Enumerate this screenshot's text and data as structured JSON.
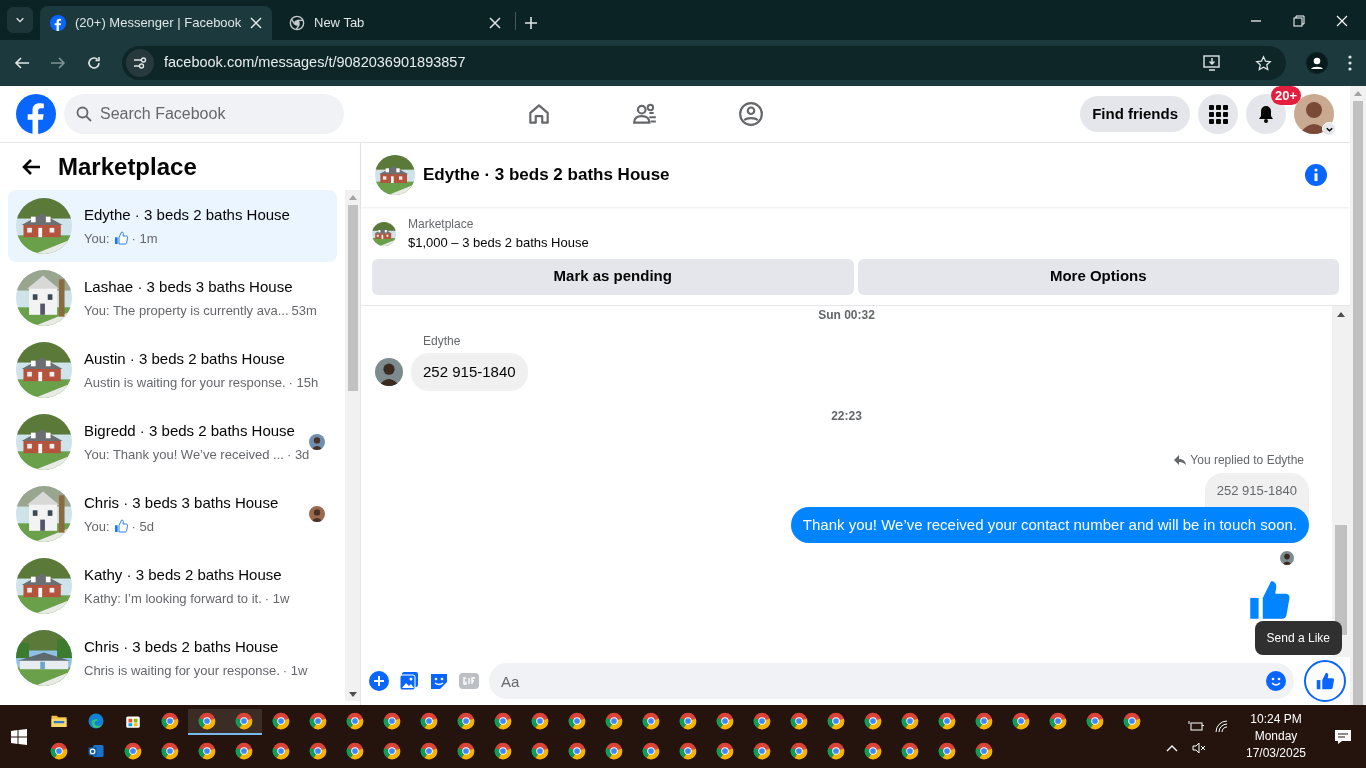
{
  "browser": {
    "tabs": [
      {
        "title": "(20+) Messenger | Facebook",
        "selected": true
      },
      {
        "title": "New Tab",
        "selected": false
      }
    ],
    "url": "facebook.com/messages/t/9082036901893857"
  },
  "header": {
    "search_placeholder": "Search Facebook",
    "nav": [
      {
        "kind": "home",
        "selected": false
      },
      {
        "kind": "friends",
        "selected": false
      },
      {
        "kind": "groups",
        "selected": false
      }
    ],
    "find_friends": "Find friends",
    "notifications_badge": "20+"
  },
  "sidebar": {
    "title": "Marketplace",
    "conversations": [
      {
        "title": "Edythe · 3 beds 2 baths House",
        "preview": "You:",
        "like": true,
        "time": "· 1m",
        "seen": false,
        "selected": true
      },
      {
        "title": "Lashae · 3 beds 3 baths House",
        "preview": "You: The property is currently ava...",
        "like": false,
        "time": "53m",
        "seen": false,
        "selected": false
      },
      {
        "title": "Austin · 3 beds 2 baths House",
        "preview": "Austin is waiting for your response.",
        "like": false,
        "time": "· 15h",
        "seen": false,
        "selected": false
      },
      {
        "title": "Bigredd · 3 beds 2 baths House",
        "preview": "You: Thank you! We’ve received ...",
        "like": false,
        "time": "· 3d",
        "seen": true,
        "selected": false
      },
      {
        "title": "Chris · 3 beds 3 baths House",
        "preview": "You:",
        "like": true,
        "time": "· 5d",
        "seen": true,
        "selected": false
      },
      {
        "title": "Kathy · 3 beds 2 baths House",
        "preview": "Kathy: I’m looking forward to it.",
        "like": false,
        "time": "· 1w",
        "seen": false,
        "selected": false
      },
      {
        "title": "Chris · 3 beds 2 baths House",
        "preview": "Chris is waiting for your response.",
        "like": false,
        "time": "· 1w",
        "seen": false,
        "selected": false
      }
    ]
  },
  "chat": {
    "title": "Edythe · 3 beds 2 baths House",
    "listing": {
      "source": "Marketplace",
      "title": "$1,000 – 3 beds 2 baths House"
    },
    "actions": [
      "Mark as pending",
      "More Options"
    ],
    "messages": [
      {
        "kind": "timestamp",
        "text": "Sun 00:32"
      },
      {
        "kind": "incoming",
        "sender": "Edythe",
        "text": "252 915-1840"
      },
      {
        "kind": "timestamp",
        "text": "22:23"
      },
      {
        "kind": "reply_label",
        "text": "You replied to Edythe"
      },
      {
        "kind": "quote",
        "text": "252 915-1840"
      },
      {
        "kind": "outgoing",
        "text": "Thank you! We’ve received your contact number and will be in touch soon."
      },
      {
        "kind": "seen"
      },
      {
        "kind": "like"
      }
    ],
    "composer_placeholder": "Aa",
    "tooltip": "Send a Like"
  },
  "taskbar": {
    "rows": [
      {
        "items": [
          {
            "kind": "files",
            "active": false
          },
          {
            "kind": "edge",
            "active": false
          },
          {
            "kind": "store",
            "active": false
          },
          {
            "kind": "chrome",
            "active": false
          },
          {
            "kind": "chrome",
            "active": true
          },
          {
            "kind": "chrome",
            "active": true
          },
          {
            "kind": "chrome",
            "active": false
          },
          {
            "kind": "chrome",
            "active": false
          },
          {
            "kind": "chrome",
            "active": false
          },
          {
            "kind": "chrome",
            "active": false
          },
          {
            "kind": "chrome",
            "active": false
          },
          {
            "kind": "chrome",
            "active": false
          },
          {
            "kind": "chrome",
            "active": false
          },
          {
            "kind": "chrome",
            "active": false
          },
          {
            "kind": "chrome",
            "active": false
          },
          {
            "kind": "chrome",
            "active": false
          },
          {
            "kind": "chrome",
            "active": false
          },
          {
            "kind": "chrome",
            "active": false
          },
          {
            "kind": "chrome",
            "active": false
          },
          {
            "kind": "chrome",
            "active": false
          },
          {
            "kind": "chrome",
            "active": false
          },
          {
            "kind": "chrome",
            "active": false
          },
          {
            "kind": "chrome",
            "active": false
          },
          {
            "kind": "chrome",
            "active": false
          },
          {
            "kind": "chrome",
            "active": false
          },
          {
            "kind": "chrome",
            "active": false
          },
          {
            "kind": "chrome",
            "active": false
          },
          {
            "kind": "chrome",
            "active": false
          },
          {
            "kind": "chrome",
            "active": false
          },
          {
            "kind": "chrome",
            "active": false
          }
        ]
      },
      {
        "items": [
          {
            "kind": "chrome",
            "active": false
          },
          {
            "kind": "outlook",
            "active": false
          },
          {
            "kind": "chrome",
            "active": false
          },
          {
            "kind": "chrome",
            "active": false
          },
          {
            "kind": "chrome",
            "active": false
          },
          {
            "kind": "chrome",
            "active": false
          },
          {
            "kind": "chrome",
            "active": false
          },
          {
            "kind": "chrome",
            "active": false
          },
          {
            "kind": "chrome",
            "active": false
          },
          {
            "kind": "chrome",
            "active": false
          },
          {
            "kind": "chrome",
            "active": false
          },
          {
            "kind": "chrome",
            "active": false
          },
          {
            "kind": "chrome",
            "active": false
          },
          {
            "kind": "chrome",
            "active": false
          },
          {
            "kind": "chrome",
            "active": false
          },
          {
            "kind": "chrome",
            "active": false
          },
          {
            "kind": "chrome",
            "active": false
          },
          {
            "kind": "chrome",
            "active": false
          },
          {
            "kind": "chrome",
            "active": false
          },
          {
            "kind": "chrome",
            "active": false
          },
          {
            "kind": "chrome",
            "active": false
          },
          {
            "kind": "chrome",
            "active": false
          },
          {
            "kind": "chrome",
            "active": false
          },
          {
            "kind": "chrome",
            "active": false
          },
          {
            "kind": "chrome",
            "active": false
          },
          {
            "kind": "chrome",
            "active": false
          }
        ]
      }
    ],
    "time": "10:24 PM",
    "day": "Monday",
    "date": "17/03/2025"
  }
}
